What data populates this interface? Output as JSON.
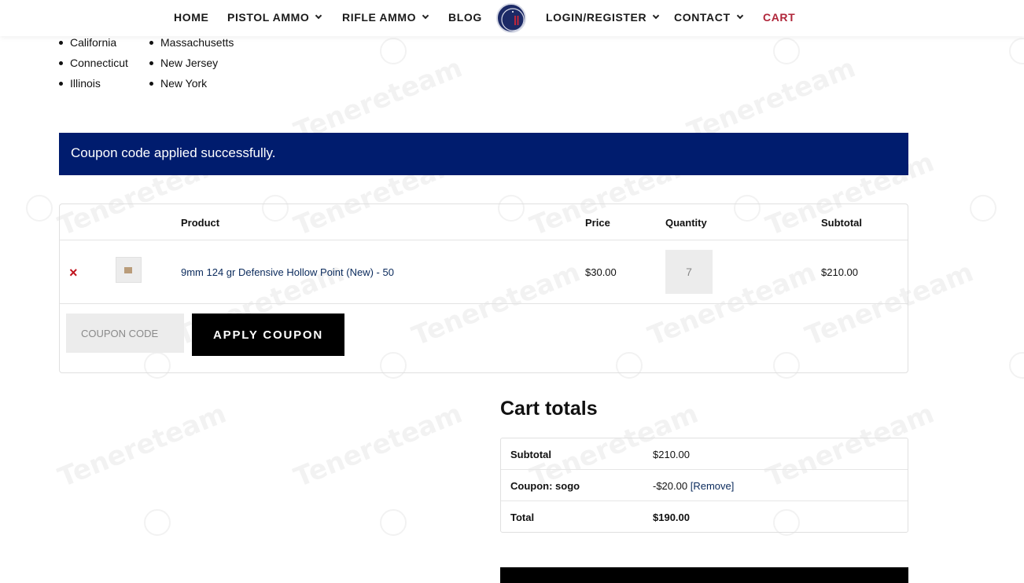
{
  "nav": {
    "home": "HOME",
    "pistol_ammo": "PISTOL AMMO",
    "rifle_ammo": "RIFLE AMMO",
    "blog": "BLOG",
    "login": "LOGIN/REGISTER",
    "contact": "CONTACT",
    "cart": "CART"
  },
  "states": {
    "col1": [
      "California",
      "Connecticut",
      "Illinois"
    ],
    "col2": [
      "Massachusetts",
      "New Jersey",
      "New York"
    ]
  },
  "notice": "Coupon code applied successfully.",
  "cart_table": {
    "headers": {
      "product": "Product",
      "price": "Price",
      "quantity": "Quantity",
      "subtotal": "Subtotal"
    },
    "row": {
      "remove": "×",
      "product": "9mm 124 gr Defensive Hollow Point (New) - 50",
      "price": "$30.00",
      "quantity": "7",
      "subtotal": "$210.00"
    },
    "coupon_placeholder": "COUPON CODE",
    "apply_label": "APPLY COUPON"
  },
  "totals": {
    "title": "Cart totals",
    "subtotal_label": "Subtotal",
    "subtotal_value": "$210.00",
    "coupon_label": "Coupon: sogo",
    "coupon_value": "-$20.00",
    "remove_label": "[Remove]",
    "total_label": "Total",
    "total_value": "$190.00"
  },
  "colors": {
    "accent_blue": "#001c6e",
    "cart_red": "#b0263a",
    "link_blue": "#0a2a5c"
  }
}
